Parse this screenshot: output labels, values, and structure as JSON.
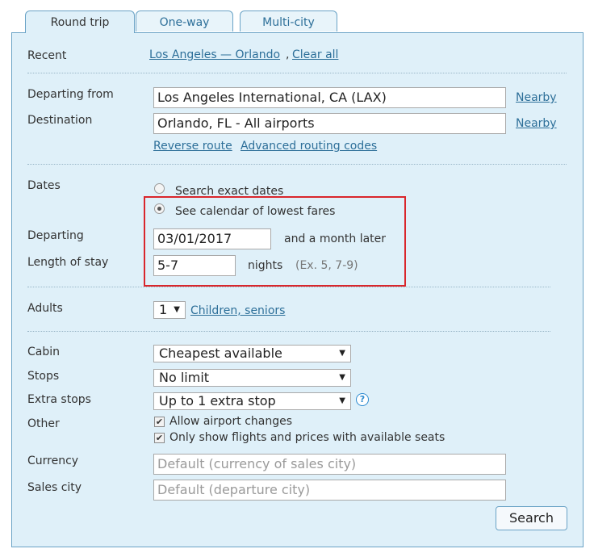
{
  "tabs": [
    {
      "label": "Round trip",
      "active": true
    },
    {
      "label": "One-way",
      "active": false
    },
    {
      "label": "Multi-city",
      "active": false
    }
  ],
  "recent": {
    "label": "Recent",
    "route_link": "Los Angeles — Orlando",
    "comma": ",",
    "clear_link": "Clear all"
  },
  "route": {
    "from_label": "Departing from",
    "from_value": "Los Angeles International, CA (LAX)",
    "dest_label": "Destination",
    "dest_value": "Orlando, FL - All airports",
    "nearby_link": "Nearby",
    "reverse_link": "Reverse route",
    "advanced_link": "Advanced routing codes"
  },
  "dates": {
    "label": "Dates",
    "option_exact": "Search exact dates",
    "option_calendar": "See calendar of lowest fares",
    "selected": "calendar",
    "departing_label": "Departing",
    "departing_value": "03/01/2017",
    "departing_note": "and a month later",
    "stay_label": "Length of stay",
    "stay_value": "5-7",
    "stay_unit": "nights",
    "stay_hint": "(Ex. 5, 7-9)"
  },
  "passengers": {
    "adults_label": "Adults",
    "adults_value": "1",
    "children_link": "Children, seniors"
  },
  "options": {
    "cabin_label": "Cabin",
    "cabin_value": "Cheapest available",
    "stops_label": "Stops",
    "stops_value": "No limit",
    "extra_label": "Extra stops",
    "extra_value": "Up to 1 extra stop",
    "help_glyph": "?",
    "other_label": "Other",
    "check1": "Allow airport changes",
    "check2": "Only show flights and prices with available seats",
    "currency_label": "Currency",
    "currency_placeholder": "Default (currency of sales city)",
    "sales_label": "Sales city",
    "sales_placeholder": "Default (departure city)"
  },
  "search_button": "Search",
  "glyphs": {
    "caret": "▼",
    "check": "✔"
  },
  "colors": {
    "panel": "#dff0f9",
    "border": "#6aa3c6",
    "link": "#2d6f99",
    "highlight": "#d9262c"
  }
}
